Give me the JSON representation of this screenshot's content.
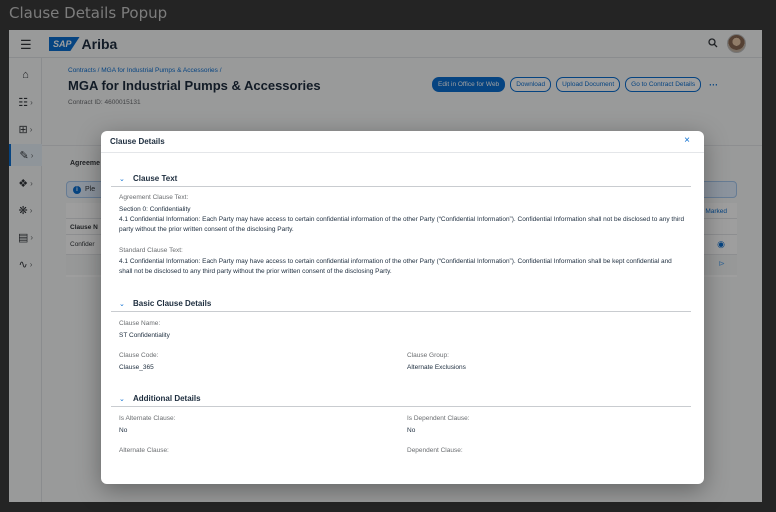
{
  "window": {
    "title": "Clause Details Popup"
  },
  "shellbar": {
    "brand": "SAP",
    "product": "Ariba"
  },
  "sidenav": {
    "icons": [
      "home-icon",
      "hierarchy-icon",
      "grid-icon",
      "edit-icon",
      "puzzle-icon",
      "org-chart-icon",
      "document-icon",
      "analytics-icon"
    ]
  },
  "page": {
    "breadcrumb": "Contracts / MGA for Industrial Pumps & Accessories /",
    "title": "MGA for Industrial Pumps & Accessories",
    "contract_id": "Contract ID: 4600015131",
    "actions": {
      "edit_office": "Edit in Office for Web",
      "download": "Download",
      "upload": "Upload Document",
      "go_to": "Go to Contract Details",
      "more": "···"
    },
    "tab_agreement": "Agreeme",
    "info_text": "Ple",
    "table": {
      "col_clause": "Clause N",
      "cell_confidential": "Confider",
      "col_marked": "Marked"
    }
  },
  "dialog": {
    "title": "Clause Details",
    "close": "×",
    "clause_text": {
      "heading": "Clause Text",
      "agreement_label": "Agreement Clause Text:",
      "agreement_section": "Section 0: Confidentiality",
      "agreement_body": "4.1 Confidential Information: Each Party may have access to certain confidential information of the other Party (“Confidential Information”). Confidential Information shall not be disclosed to any third party without the prior written consent of the disclosing Party.",
      "standard_label": "Standard Clause Text:",
      "standard_body": "4.1 Confidential Information: Each Party may have access to certain confidential information of the other Party (“Confidential Information”). Confidential Information shall be kept confidential and shall not be disclosed to any third party without the prior written consent of the disclosing Party."
    },
    "basic": {
      "heading": "Basic Clause Details",
      "name_label": "Clause Name:",
      "name_value": "ST Confidentiality",
      "code_label": "Clause Code:",
      "code_value": "Clause_365",
      "group_label": "Clause Group:",
      "group_value": "Alternate Exclusions"
    },
    "additional": {
      "heading": "Additional Details",
      "alt_label": "Is Alternate Clause:",
      "alt_value": "No",
      "dep_label": "Is Dependent Clause:",
      "dep_value": "No",
      "alternate_label": "Alternate Clause:",
      "dependent_label": "Dependent Clause:"
    }
  },
  "colors": {
    "accent": "#0a6ed1",
    "primary_button": "#0a6ed1",
    "info_bg": "#e3efff"
  }
}
